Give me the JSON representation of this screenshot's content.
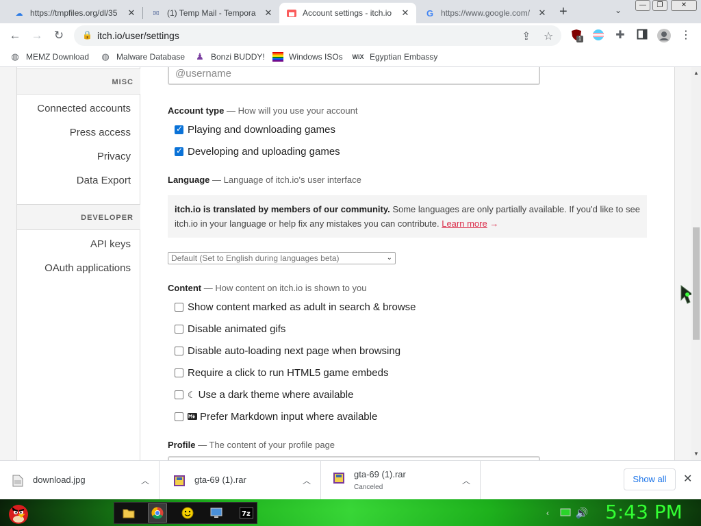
{
  "tabs": [
    {
      "title": "https://tmpfiles.org/dl/35",
      "icon": "cloud-upload-icon",
      "active": false
    },
    {
      "title": "(1) Temp Mail - Tempora",
      "icon": "mail-icon",
      "active": false
    },
    {
      "title": "Account settings - itch.io",
      "icon": "itchio-icon",
      "active": true
    },
    {
      "title": "https://www.google.com/",
      "icon": "google-icon",
      "active": false
    }
  ],
  "toolbar": {
    "url": "itch.io/user/settings",
    "badge": "1"
  },
  "bookmarks": [
    {
      "label": "MEMZ Download",
      "icon": "globe-icon"
    },
    {
      "label": "Malware Database",
      "icon": "globe-icon"
    },
    {
      "label": "Bonzi BUDDY!",
      "icon": "bonzi-icon"
    },
    {
      "label": "Windows ISOs",
      "icon": "windows-flag-icon"
    },
    {
      "label": "Egyptian Embassy",
      "icon": "wix-icon",
      "icon_text": "WiX"
    }
  ],
  "sidebar": {
    "sections": [
      {
        "heading": "MISC",
        "items": [
          "Connected accounts",
          "Press access",
          "Privacy",
          "Data Export"
        ]
      },
      {
        "heading": "DEVELOPER",
        "items": [
          "API keys",
          "OAuth applications"
        ]
      }
    ]
  },
  "settings": {
    "username_placeholder": "@username",
    "account_type": {
      "label": "Account type",
      "desc": "— How will you use your account",
      "options": [
        {
          "label": "Playing and downloading games",
          "checked": true
        },
        {
          "label": "Developing and uploading games",
          "checked": true
        }
      ]
    },
    "language": {
      "label": "Language",
      "desc": "— Language of itch.io's user interface",
      "notice_bold": "itch.io is translated by members of our community.",
      "notice_text": " Some languages are only partially available. If you'd like to see itch.io in your language or help fix any mistakes you can contribute. ",
      "notice_link": "Learn more",
      "notice_arrow": "→",
      "select_value": "Default (Set to English during languages beta)"
    },
    "content": {
      "label": "Content",
      "desc": "— How content on itch.io is shown to you",
      "options": [
        {
          "label": "Show content marked as adult in search & browse",
          "checked": false
        },
        {
          "label": "Disable animated gifs",
          "checked": false
        },
        {
          "label": "Disable auto-loading next page when browsing",
          "checked": false
        },
        {
          "label": "Require a click to run HTML5 game embeds",
          "checked": false
        },
        {
          "label": "Use a dark theme where available",
          "checked": false,
          "icon": "moon-icon"
        },
        {
          "label": "Prefer Markdown input where available",
          "checked": false,
          "icon": "markdown-icon"
        }
      ]
    },
    "profile": {
      "label": "Profile",
      "desc": "— The content of your profile page"
    }
  },
  "downloads": {
    "items": [
      {
        "name": "download.jpg",
        "status": "",
        "icon": "image-file-icon"
      },
      {
        "name": "gta-69 (1).rar",
        "status": "",
        "icon": "rar-file-icon"
      },
      {
        "name": "gta-69 (1).rar",
        "status": "Canceled",
        "icon": "rar-file-icon"
      }
    ],
    "show_all": "Show all"
  },
  "taskbar": {
    "clock": "5:43 PM",
    "icons": [
      "angry-bird-start-icon",
      "folder-icon",
      "chrome-icon",
      "smiley-icon",
      "monitor-icon",
      "7zip-icon"
    ]
  },
  "colors": {
    "accent": "#da2c49",
    "checkbox": "#0a72d7",
    "link": "#1a73e8",
    "clock": "#33ff33"
  }
}
